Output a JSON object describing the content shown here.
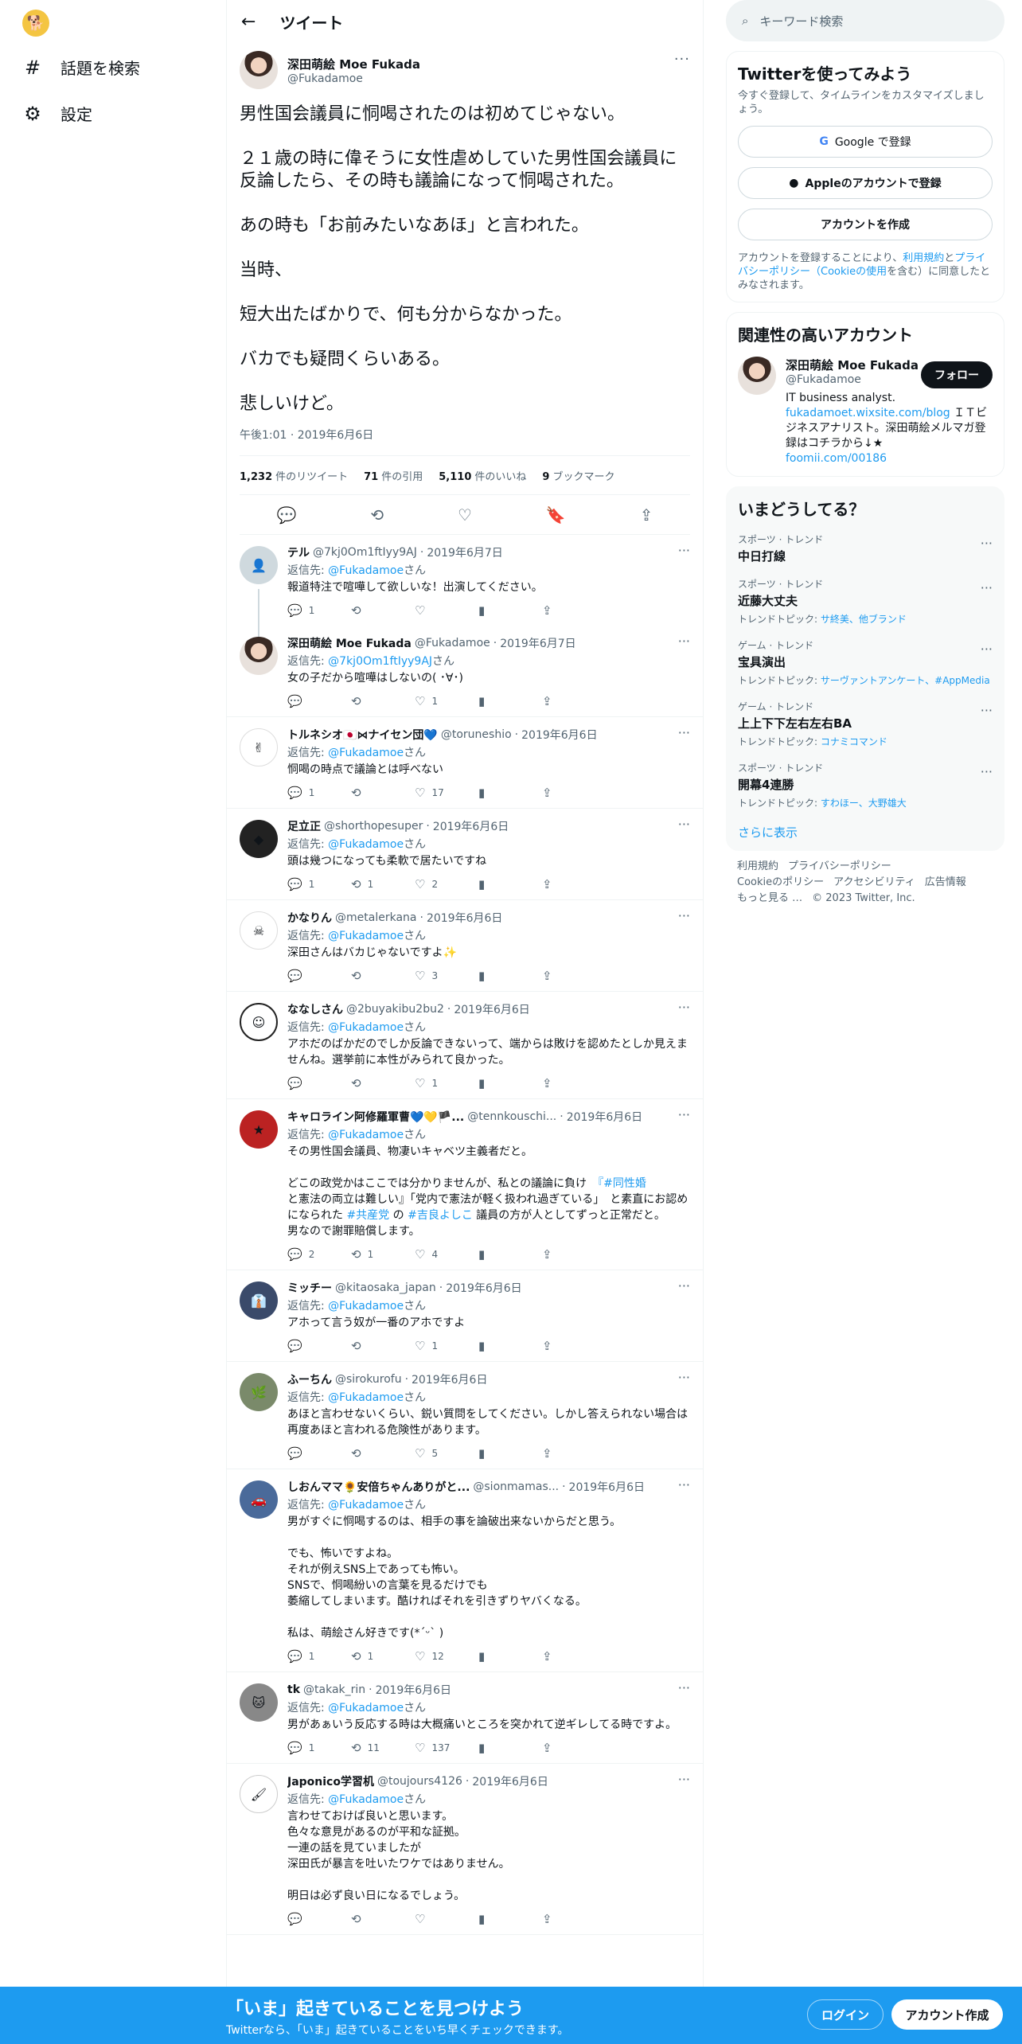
{
  "nav": {
    "explore": "話題を検索",
    "settings": "設定"
  },
  "header": {
    "title": "ツイート"
  },
  "post": {
    "name": "深田萌絵 Moe Fukada",
    "handle": "@Fukadamoe",
    "text": "男性国会議員に恫喝されたのは初めてじゃない。\n\n２１歳の時に偉そうに女性虐めしていた男性国会議員に反論したら、その時も議論になって恫喝された。\n\nあの時も「お前みたいなあほ」と言われた。\n\n当時、\n\n短大出たばかりで、何も分からなかった。\n\nバカでも疑問くらいある。\n\n悲しいけど。",
    "time": "午後1:01 · 2019年6月6日",
    "stats": {
      "retweets": "1,232",
      "retweets_label": "件のリツイート",
      "quotes": "71",
      "quotes_label": "件の引用",
      "likes": "5,110",
      "likes_label": "件のいいね",
      "bookmarks": "9",
      "bookmarks_label": "ブックマーク"
    }
  },
  "replies": [
    {
      "name": "テル",
      "handle": "@7kj0Om1ftIyy9AJ",
      "date": "2019年6月7日",
      "replyto": "@Fukadamoe",
      "suffix": "さん",
      "text": "報道特注で喧嘩して欲しいな！出演してください。",
      "reply": "1",
      "rt": "",
      "like": ""
    },
    {
      "name": "深田萌絵 Moe Fukada",
      "handle": "@Fukadamoe",
      "date": "2019年6月7日",
      "replyto": "@7kj0Om1ftIyy9AJ",
      "suffix": "さん",
      "text": "女の子だから喧嘩はしないの( ･∀･)",
      "reply": "",
      "rt": "",
      "like": "1"
    },
    {
      "name": "トルネシオ🇯🇵⋈ナイセン団💙",
      "handle": "@toruneshio",
      "date": "2019年6月6日",
      "replyto": "@Fukadamoe",
      "suffix": "さん",
      "text": "恫喝の時点で議論とは呼べない",
      "reply": "1",
      "rt": "",
      "like": "17"
    },
    {
      "name": "足立正",
      "handle": "@shorthopesuper",
      "date": "2019年6月6日",
      "replyto": "@Fukadamoe",
      "suffix": "さん",
      "text": "頭は幾つになっても柔軟で居たいですね",
      "reply": "1",
      "rt": "1",
      "like": "2"
    },
    {
      "name": "かなりん",
      "handle": "@metalerkana",
      "date": "2019年6月6日",
      "replyto": "@Fukadamoe",
      "suffix": "さん",
      "text": "深田さんはバカじゃないですよ✨",
      "reply": "",
      "rt": "",
      "like": "3"
    },
    {
      "name": "ななしさん",
      "handle": "@2buyakibu2bu2",
      "date": "2019年6月6日",
      "replyto": "@Fukadamoe",
      "suffix": "さん",
      "text": "アホだのばかだのでしか反論できないって、端からは敗けを認めたとしか見えませんね。選挙前に本性がみられて良かった。",
      "reply": "",
      "rt": "",
      "like": "1"
    },
    {
      "name": "キャロライン阿修羅軍曹💙💛🏴...",
      "handle": "@tennkouschi...",
      "date": "2019年6月6日",
      "replyto": "@Fukadamoe",
      "suffix": "さん",
      "text_parts": [
        "その男性国会議員、物凄いキャベツ主義者だと。\n\nどこの政党かはここでは分かりませんが、私との議論に負け　",
        "『#同性婚",
        "\nと憲法の両立は難しい』「党内で憲法が軽く扱われ過ぎている」　と素直にお認めになられた ",
        "#共産党",
        " の ",
        "#吉良よしこ",
        " 議員の方が人としてずっと正常だと。\n男なので謝罪賠償します。"
      ],
      "reply": "2",
      "rt": "1",
      "like": "4"
    },
    {
      "name": "ミッチー",
      "handle": "@kitaosaka_japan",
      "date": "2019年6月6日",
      "replyto": "@Fukadamoe",
      "suffix": "さん",
      "text": "アホって言う奴が一番のアホですよ",
      "reply": "",
      "rt": "",
      "like": "1"
    },
    {
      "name": "ふーちん",
      "handle": "@sirokurofu",
      "date": "2019年6月6日",
      "replyto": "@Fukadamoe",
      "suffix": "さん",
      "text": "あほと言わせないくらい、鋭い質問をしてください。しかし答えられない場合は再度あほと言われる危険性があります。",
      "reply": "",
      "rt": "",
      "like": "5"
    },
    {
      "name": "しおんママ🌻安倍ちゃんありがと...",
      "handle": "@sionmamas...",
      "date": "2019年6月6日",
      "replyto": "@Fukadamoe",
      "suffix": "さん",
      "text": "男がすぐに恫喝するのは、相手の事を論破出来ないからだと思う。\n\nでも、怖いですよね。\nそれが例えSNS上であっても怖い。\nSNSで、恫喝紛いの言葉を見るだけでも\n萎縮してしまいます。酷ければそれを引きずりヤバくなる。\n\n私は、萌絵さん好きです(*ˊᵕˋ )",
      "reply": "1",
      "rt": "1",
      "like": "12"
    },
    {
      "name": "tk",
      "handle": "@takak_rin",
      "date": "2019年6月6日",
      "replyto": "@Fukadamoe",
      "suffix": "さん",
      "text": "男があぁいう反応する時は大概痛いところを突かれて逆ギレしてる時ですよ。",
      "reply": "1",
      "rt": "11",
      "like": "137"
    },
    {
      "name": "Japonico学習机",
      "handle": "@toujours4126",
      "date": "2019年6月6日",
      "replyto": "@Fukadamoe",
      "suffix": "さん",
      "text": "言わせておけば良いと思います。\n色々な意見があるのが平和な証拠。\n一連の話を見ていましたが\n深田氏が暴言を吐いたワケではありません。\n\n明日は必ず良い日になるでしょう。",
      "reply": "",
      "rt": "",
      "like": ""
    }
  ],
  "right": {
    "search_placeholder": "キーワード検索",
    "signup": {
      "title": "Twitterを使ってみよう",
      "desc": "今すぐ登録して、タイムラインをカスタマイズしましょう。",
      "google": "Google で登録",
      "apple": "Appleのアカウントで登録",
      "create": "アカウントを作成",
      "terms_1": "アカウントを登録することにより、",
      "terms_link1": "利用規約",
      "terms_2": "と",
      "terms_link2": "プライバシーポリシー（Cookieの使用",
      "terms_3": "を含む）に同意したとみなされます。"
    },
    "related": {
      "title": "関連性の高いアカウント",
      "name": "深田萌絵 Moe Fukada",
      "handle": "@Fukadamoe",
      "follow": "フォロー",
      "bio_1": "IT business analyst.",
      "bio_link1": "fukadamoet.wixsite.com/blog",
      "bio_2": " ＩＴビジネスアナリスト。深田萌絵メルマガ登録はコチラから↓★",
      "bio_link2": "foomii.com/00186"
    },
    "trends": {
      "title": "いまどうしてる？",
      "items": [
        {
          "cat": "スポーツ · トレンド",
          "name": "中日打線",
          "sub_label": "",
          "sub_link": ""
        },
        {
          "cat": "スポーツ · トレンド",
          "name": "近藤大丈夫",
          "sub_label": "トレンドトピック: ",
          "sub_link": "サ終美、他ブランド"
        },
        {
          "cat": "ゲーム · トレンド",
          "name": "宝具演出",
          "sub_label": "トレンドトピック: ",
          "sub_link": "サーヴァントアンケート、#AppMedia"
        },
        {
          "cat": "ゲーム · トレンド",
          "name": "上上下下左右左右BA",
          "sub_label": "トレンドトピック: ",
          "sub_link": "コナミコマンド"
        },
        {
          "cat": "スポーツ · トレンド",
          "name": "開幕4連勝",
          "sub_label": "トレンドトピック: ",
          "sub_link": "すわほー、大野雄大"
        }
      ],
      "show_more": "さらに表示"
    },
    "footer": {
      "terms": "利用規約",
      "privacy": "プライバシーポリシー",
      "cookie": "Cookieのポリシー",
      "access": "アクセシビリティ",
      "ads": "広告情報",
      "more": "もっと見る …",
      "copy": "© 2023 Twitter, Inc."
    }
  },
  "bottombar": {
    "title": "「いま」起きていることを見つけよう",
    "sub": "Twitterなら、「いま」起きていることをいち早くチェックできます。",
    "login": "ログイン",
    "signup": "アカウント作成"
  },
  "colors": {
    "accent": "#1d9bf0",
    "text": "#0f1419",
    "muted": "#536471"
  }
}
